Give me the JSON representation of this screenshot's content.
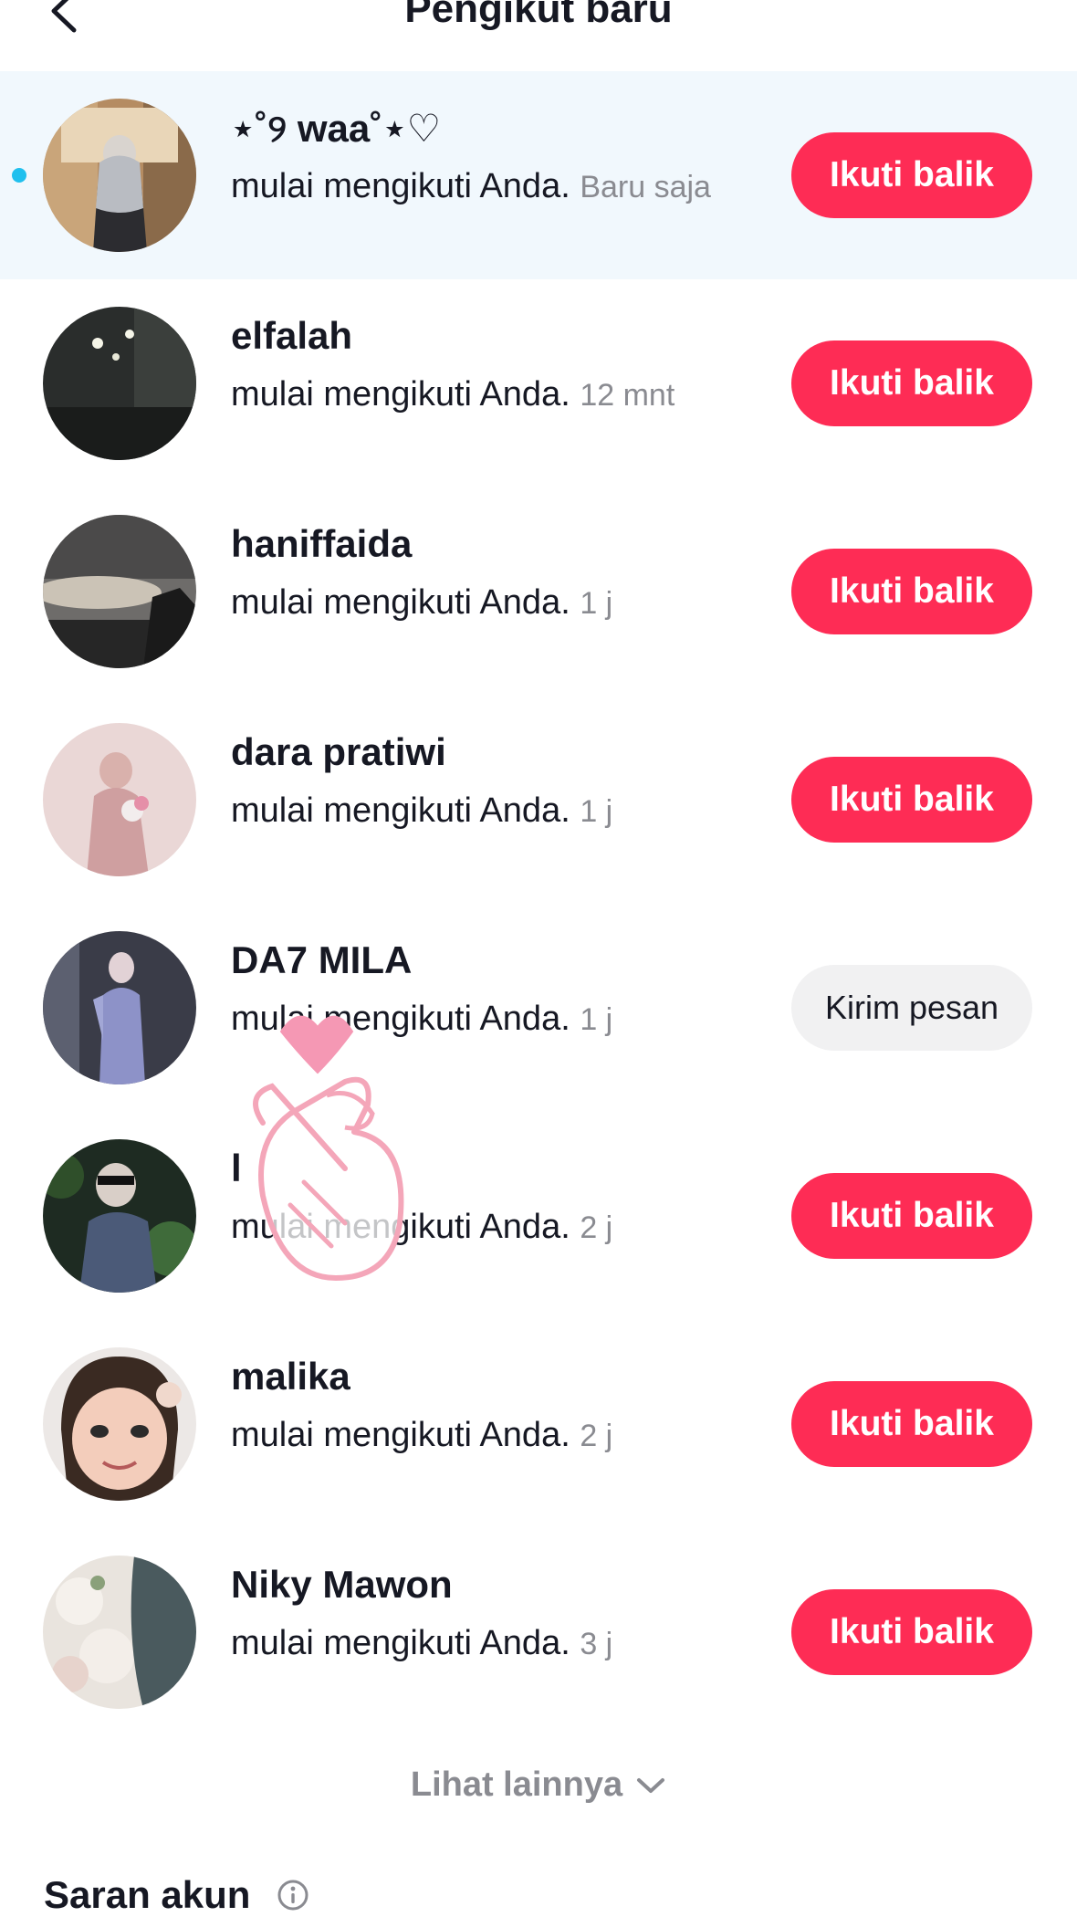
{
  "header": {
    "title": "Pengikut baru",
    "back_icon": "chevron-left-icon"
  },
  "colors": {
    "follow_button": "#fe2c55",
    "message_button": "#f1f1f2",
    "unread_dot": "#20c0ee",
    "highlight_row": "#f1f8fd",
    "secondary_text": "#8a8b91"
  },
  "followers": [
    {
      "name": "⋆˚୨ waa˚⋆♡",
      "desc": "mulai mengikuti Anda.",
      "time": "Baru saja",
      "action": "Ikuti balik",
      "unread": true
    },
    {
      "name": "elfalah",
      "desc": "mulai mengikuti Anda.",
      "time": "12 mnt",
      "action": "Ikuti balik"
    },
    {
      "name": "haniffaida",
      "desc": "mulai mengikuti Anda.",
      "time": "1 j",
      "action": "Ikuti balik"
    },
    {
      "name": "dara pratiwi",
      "desc": "mulai mengikuti Anda.",
      "time": "1 j",
      "action": "Ikuti balik"
    },
    {
      "name": "DA7 MILA",
      "desc": "mulai mengikuti Anda.",
      "time": "1 j",
      "action": "Kirim pesan"
    },
    {
      "name": "l",
      "desc": "mulai mengikuti Anda.",
      "time": "2 j",
      "action": "Ikuti balik"
    },
    {
      "name": "malika",
      "desc": "mulai mengikuti Anda.",
      "time": "2 j",
      "action": "Ikuti balik"
    },
    {
      "name": "Niky Mawon",
      "desc": "mulai mengikuti Anda.",
      "time": "3 j",
      "action": "Ikuti balik"
    }
  ],
  "see_more": {
    "label": "Lihat lainnya",
    "icon": "chevron-down-icon"
  },
  "suggestions": {
    "title": "Saran akun",
    "icon": "info-icon"
  }
}
